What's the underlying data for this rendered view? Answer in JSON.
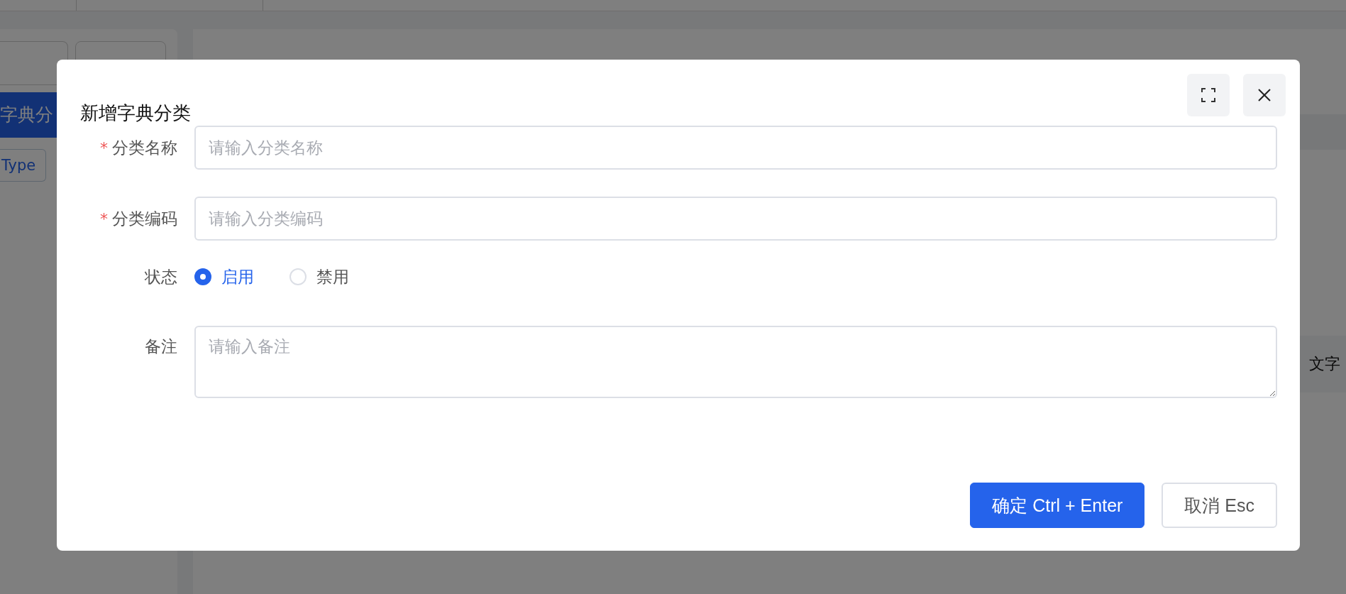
{
  "background": {
    "sidebar": {
      "button_label": "字典分",
      "tag": "Type"
    },
    "table": {
      "column_1": "文字"
    }
  },
  "dialog": {
    "title": "新增字典分类",
    "fields": [
      {
        "kind": "input",
        "label": "分类名称",
        "required_mark": "*",
        "placeholder": "请输入分类名称"
      },
      {
        "kind": "input",
        "label": "分类编码",
        "required_mark": "*",
        "placeholder": "请输入分类编码"
      },
      {
        "kind": "radio",
        "label": "状态",
        "options": [
          {
            "label": "启用",
            "selected": true
          },
          {
            "label": "禁用",
            "selected": false
          }
        ]
      },
      {
        "kind": "textarea",
        "label": "备注",
        "placeholder": "请输入备注"
      }
    ],
    "buttons": [
      {
        "label": "确定 Ctrl + Enter",
        "kind": "primary"
      },
      {
        "label": "取消 Esc",
        "kind": "default"
      }
    ]
  }
}
